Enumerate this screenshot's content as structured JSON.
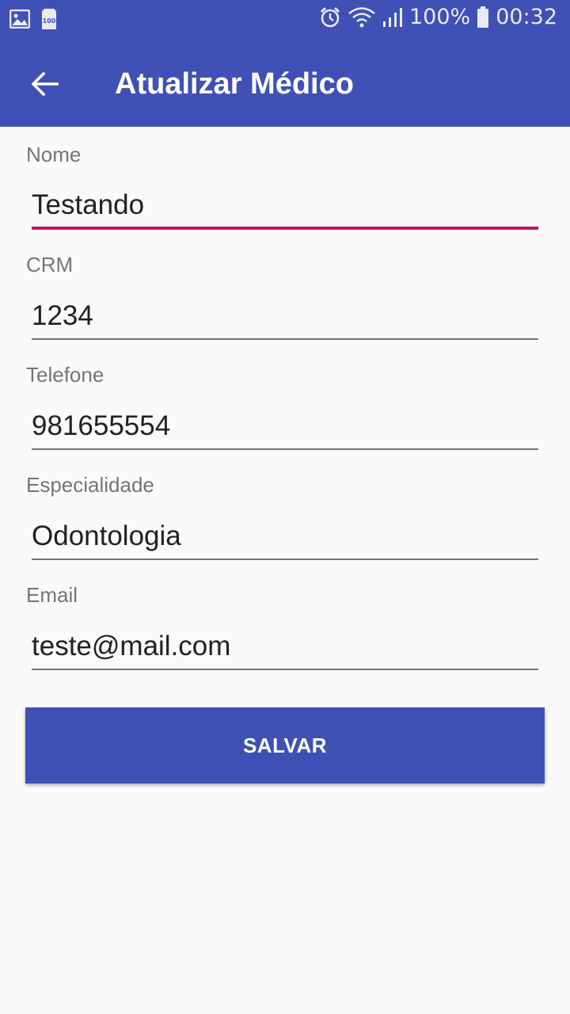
{
  "status_bar": {
    "left_icons": [
      "image-icon",
      "storage-icon"
    ],
    "right_icons": [
      "alarm-icon",
      "wifi-icon",
      "signal-icon",
      "battery-icon"
    ],
    "storage_badge": "100",
    "battery_percent": "100%",
    "time": "00:32"
  },
  "toolbar": {
    "back_icon": "arrow-left-icon",
    "title": "Atualizar Médico"
  },
  "form": {
    "fields": [
      {
        "label": "Nome",
        "value": "Testando"
      },
      {
        "label": "CRM",
        "value": "1234"
      },
      {
        "label": "Telefone",
        "value": "981655554"
      },
      {
        "label": "Especialidade",
        "value": "Odontologia"
      },
      {
        "label": "Email",
        "value": "teste@mail.com"
      }
    ],
    "submit_label": "SALVAR"
  },
  "colors": {
    "primary": "#3f51b5",
    "accent": "#c2185b",
    "background": "#fafafa"
  }
}
